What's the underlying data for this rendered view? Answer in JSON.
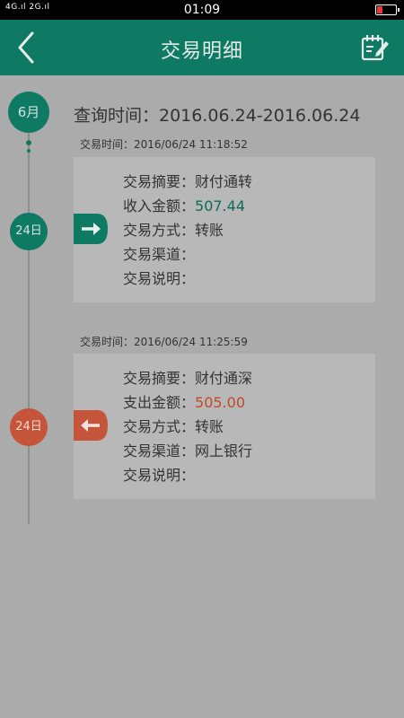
{
  "status_bar": {
    "left": "4G.ıl 2G.ıl",
    "time": "01:09"
  },
  "header": {
    "title": "交易明细"
  },
  "timeline": {
    "month": "6月"
  },
  "query": {
    "text": "查询时间：2016.06.24-2016.06.24"
  },
  "transactions": [
    {
      "time": "交易时间：2016/06/24  11:18:52",
      "day": "24日",
      "direction": "in",
      "summary_label": "交易摘要：",
      "summary": "财付通转",
      "amount_label": "收入金额：",
      "amount": "507.44",
      "method_label": "交易方式：",
      "method": "转账",
      "channel_label": "交易渠道：",
      "channel": "",
      "note_label": "交易说明：",
      "note": ""
    },
    {
      "time": "交易时间：2016/06/24  11:25:59",
      "day": "24日",
      "direction": "out",
      "summary_label": "交易摘要：",
      "summary": "财付通深",
      "amount_label": "支出金额：",
      "amount": "505.00",
      "method_label": "交易方式：",
      "method": "转账",
      "channel_label": "交易渠道：",
      "channel": "网上银行",
      "note_label": "交易说明：",
      "note": ""
    }
  ],
  "colors": {
    "primary": "#0f7a64",
    "income": "#0c6b55",
    "expense": "#c4472a"
  }
}
